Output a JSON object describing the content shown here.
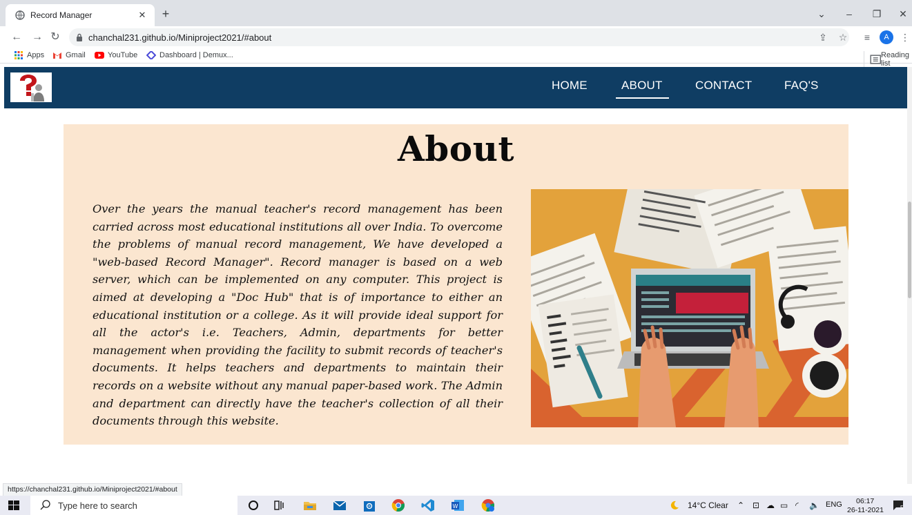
{
  "browser": {
    "tab_title": "Record Manager",
    "url": "chanchal231.github.io/Miniproject2021/#about",
    "bookmarks": [
      "Apps",
      "Gmail",
      "YouTube",
      "Dashboard | Demux..."
    ],
    "reading_list": "Reading list",
    "profile_initial": "A",
    "status_url": "https://chanchal231.github.io/Miniproject2021/#about"
  },
  "site": {
    "nav": [
      {
        "label": "HOME",
        "active": false
      },
      {
        "label": "ABOUT",
        "active": true
      },
      {
        "label": "CONTACT",
        "active": false
      },
      {
        "label": "FAQ'S",
        "active": false
      }
    ],
    "about_title": "About",
    "about_text": "Over the years the manual teacher's record management has been carried across most educational institutions all over India. To overcome the problems of manual record management, We have developed a \"web-based Record Manager\". Record manager is based on a web server, which can be implemented on any computer. This project is aimed at developing a \"Doc Hub\" that is of importance to either an educational institution or a college. As it will provide ideal support for all the actor's i.e. Teachers, Admin, departments for better management when providing the facility to submit records of teacher's documents. It helps teachers and departments to maintain their records on a website without any manual paper-based work. The Admin and department can directly have the teacher's collection of all their documents through this website."
  },
  "taskbar": {
    "search_placeholder": "Type here to search",
    "weather": "14°C Clear",
    "lang": "ENG",
    "time": "06:17",
    "date": "26-11-2021",
    "notif_count": "5"
  },
  "colors": {
    "nav_bg": "#0f3d63",
    "about_bg": "#fbe6d0",
    "illus_orange": "#e3a23b"
  }
}
